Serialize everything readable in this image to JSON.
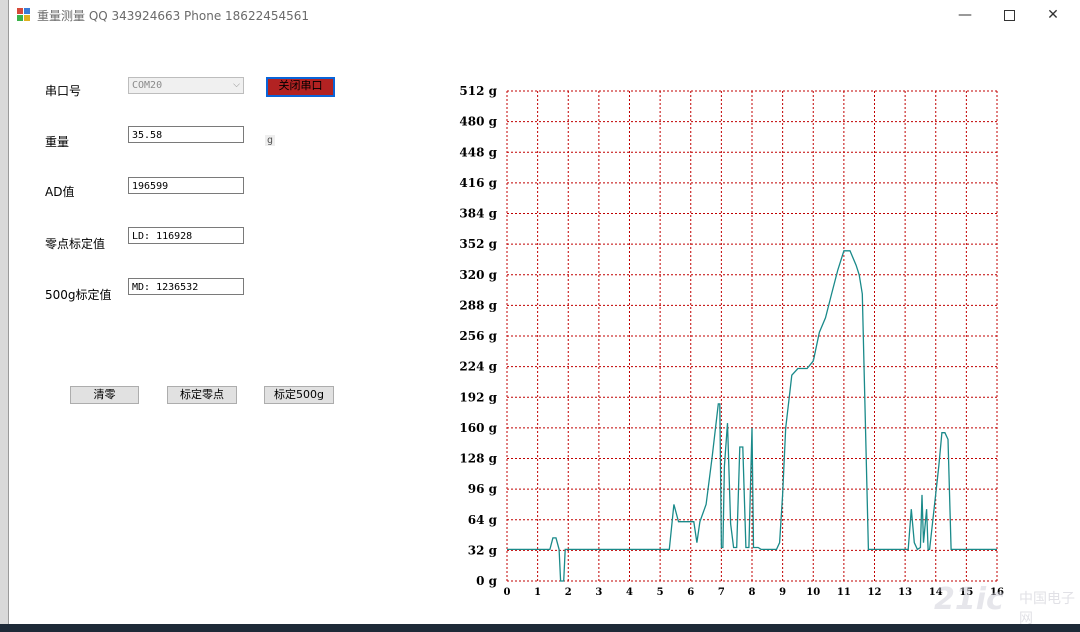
{
  "window": {
    "title": "重量测量 QQ 343924663 Phone 18622454561",
    "minimize_glyph": "—",
    "close_glyph": "✕"
  },
  "form": {
    "port_label": "串口号",
    "port_value": "COM20",
    "close_port_button": "关闭串口",
    "weight_label": "重量",
    "weight_value": "35.58",
    "weight_unit": "g",
    "ad_label": "AD值",
    "ad_value": "196599",
    "zero_label": "零点标定值",
    "zero_value": "LD: 116928",
    "cal500_label": "500g标定值",
    "cal500_value": "MD: 1236532"
  },
  "buttons": {
    "clear": "清零",
    "calibrate_zero": "标定零点",
    "calibrate_500": "标定500g"
  },
  "watermark": {
    "text": "21ic",
    "sub": "中国电子网"
  },
  "colors": {
    "grid": "#c00000",
    "line": "#1a8a8a",
    "button_active": "#b22222"
  },
  "chart_data": {
    "type": "line",
    "unit": "g",
    "xlim": [
      0,
      16
    ],
    "ylim": [
      0,
      512
    ],
    "x_ticks": [
      "0",
      "1",
      "2",
      "3",
      "4",
      "5",
      "6",
      "7",
      "8",
      "9",
      "10",
      "11",
      "12",
      "13",
      "14",
      "15",
      "16"
    ],
    "y_ticks": [
      "0 g",
      "32 g",
      "64 g",
      "96 g",
      "128 g",
      "160 g",
      "192 g",
      "224 g",
      "256 g",
      "288 g",
      "320 g",
      "352 g",
      "384 g",
      "416 g",
      "448 g",
      "480 g",
      "512 g"
    ],
    "grid": true,
    "series": [
      {
        "x": [
          0,
          1.4,
          1.5,
          1.6,
          1.7,
          1.75,
          1.85,
          1.9,
          2.0,
          5.0,
          5.3,
          5.45,
          5.6,
          5.7,
          5.9,
          6.1,
          6.2,
          6.3,
          6.5,
          6.7,
          6.9,
          6.95,
          7.0,
          7.05,
          7.1,
          7.2,
          7.3,
          7.4,
          7.5,
          7.6,
          7.7,
          7.8,
          7.9,
          8.0,
          8.05,
          8.1,
          8.2,
          8.3,
          8.8,
          8.9,
          9.0,
          9.1,
          9.3,
          9.5,
          9.8,
          10.0,
          10.2,
          10.4,
          10.6,
          10.8,
          11.0,
          11.2,
          11.4,
          11.5,
          11.6,
          11.8,
          11.9,
          11.95,
          12.0,
          12.1,
          12.2,
          13.0,
          13.1,
          13.2,
          13.3,
          13.4,
          13.5,
          13.55,
          13.6,
          13.7,
          13.75,
          13.8,
          14.1,
          14.2,
          14.3,
          14.4,
          14.5,
          14.6,
          14.7,
          14.8,
          15.5,
          16.0
        ],
        "y": [
          33,
          33,
          45,
          45,
          33,
          0,
          0,
          33,
          33,
          33,
          33,
          80,
          62,
          62,
          62,
          62,
          40,
          62,
          80,
          130,
          185,
          185,
          35,
          35,
          120,
          165,
          60,
          35,
          35,
          140,
          140,
          35,
          35,
          160,
          35,
          35,
          35,
          33,
          33,
          40,
          90,
          160,
          215,
          222,
          222,
          230,
          260,
          275,
          300,
          325,
          345,
          345,
          330,
          320,
          300,
          33,
          33,
          33,
          33,
          33,
          33,
          33,
          33,
          75,
          40,
          33,
          35,
          90,
          40,
          75,
          33,
          33,
          120,
          155,
          155,
          148,
          33,
          33,
          33,
          33,
          33,
          33
        ]
      }
    ]
  }
}
